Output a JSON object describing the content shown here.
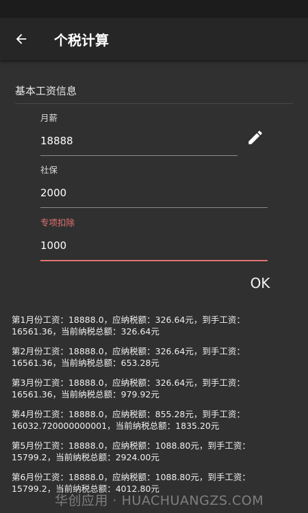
{
  "appbar": {
    "title": "个税计算"
  },
  "section": {
    "title": "基本工资信息"
  },
  "fields": {
    "salary": {
      "label": "月薪",
      "value": "18888"
    },
    "social": {
      "label": "社保",
      "value": "2000"
    },
    "deduction": {
      "label": "专项扣除",
      "value": "1000"
    }
  },
  "ok_label": "OK",
  "results": [
    "第1月份工资：18888.0，应纳税额：326.64元，到手工资：\n16561.36，当前纳税总额：326.64元",
    "第2月份工资：18888.0，应纳税额：326.64元，到手工资：\n16561.36，当前纳税总额：653.28元",
    "第3月份工资：18888.0，应纳税额：326.64元，到手工资：\n16561.36，当前纳税总额：979.92元",
    "第4月份工资：18888.0，应纳税额：855.28元，到手工资：\n16032.720000000001，当前纳税总额：1835.20元",
    "第5月份工资：18888.0，应纳税额：1088.80元，到手工资：\n15799.2，当前纳税总额：2924.00元",
    "第6月份工资：18888.0，应纳税额：1088.80元，到手工资：\n15799.2，当前纳税总额：4012.80元"
  ],
  "watermark": "华创应用 · HUACHUANGZS.COM",
  "colors": {
    "accent": "#e57373",
    "background": "#303030",
    "appbar": "#262626"
  }
}
